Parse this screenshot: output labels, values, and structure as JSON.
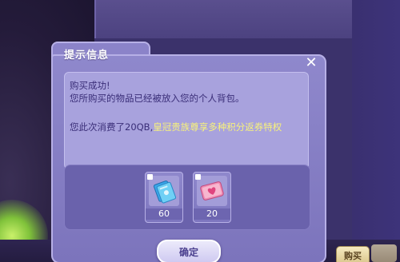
{
  "background": {
    "top_text": "",
    "buy_button_label": "购买"
  },
  "dialog": {
    "title": "提示信息",
    "close_symbol": "✕",
    "message": {
      "line1": "购买成功!",
      "line2": "您所购买的物品已经被放入您的个人背包。",
      "cost_text": "您此次消费了20QB,",
      "privilege_text": "皇冠贵族尊享多种积分返券特权"
    },
    "items": [
      {
        "icon": "blue-ticket-icon",
        "count": "60"
      },
      {
        "icon": "pink-heart-card-icon",
        "count": "20"
      }
    ],
    "confirm_label": "确定"
  },
  "colors": {
    "dialog_bg": "#8f88cc",
    "message_text": "#3a2e78",
    "highlight_text": "#f8f27a"
  }
}
